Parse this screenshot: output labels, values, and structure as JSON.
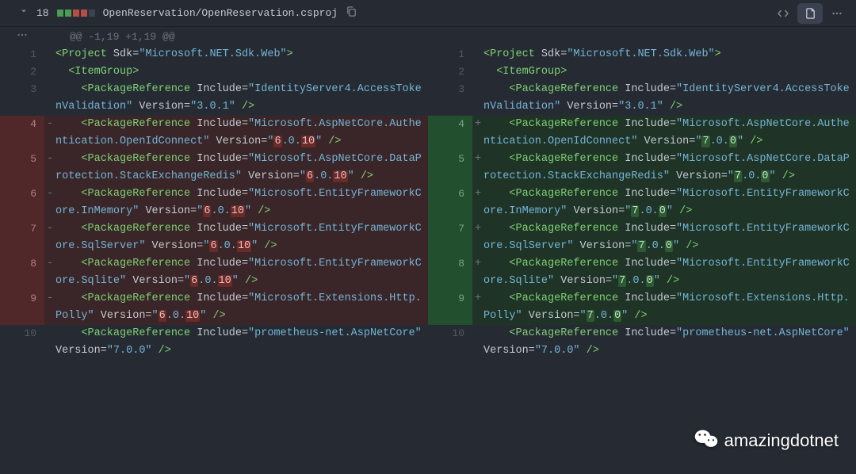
{
  "header": {
    "changed_lines": "18",
    "path": "OpenReservation/OpenReservation.csproj"
  },
  "hunk": "@@ -1,19 +1,19 @@",
  "watermark": "amazingdotnet",
  "lines": {
    "left": [
      {
        "num": "1",
        "type": "ctx",
        "indent": 0,
        "segs": [
          {
            "t": "tag",
            "v": "<Project "
          },
          {
            "t": "attr",
            "v": "Sdk="
          },
          {
            "t": "str",
            "v": "\"Microsoft.NET.Sdk.Web\""
          },
          {
            "t": "tag",
            "v": ">"
          }
        ]
      },
      {
        "num": "2",
        "type": "ctx",
        "indent": 2,
        "segs": [
          {
            "t": "tag",
            "v": "<ItemGroup>"
          }
        ]
      },
      {
        "num": "3",
        "type": "ctx",
        "indent": 4,
        "segs": [
          {
            "t": "tag",
            "v": "<PackageReference "
          },
          {
            "t": "attr",
            "v": "Include="
          },
          {
            "t": "str",
            "v": "\"IdentityServer4.AccessTokenValidation\""
          },
          {
            "t": "punc",
            "v": " "
          },
          {
            "t": "attr",
            "v": "Version="
          },
          {
            "t": "str",
            "v": "\"3.0.1\""
          },
          {
            "t": "tag",
            "v": " />"
          }
        ]
      },
      {
        "num": "4",
        "type": "del",
        "indent": 4,
        "segs": [
          {
            "t": "tag",
            "v": "<PackageReference "
          },
          {
            "t": "attr",
            "v": "Include="
          },
          {
            "t": "str",
            "v": "\"Microsoft.AspNetCore.Authentication.OpenIdConnect\""
          },
          {
            "t": "punc",
            "v": " "
          },
          {
            "t": "attr",
            "v": "Version="
          },
          {
            "t": "str",
            "v": "\""
          },
          {
            "t": "hl",
            "v": "6"
          },
          {
            "t": "str",
            "v": ".0."
          },
          {
            "t": "hl",
            "v": "10"
          },
          {
            "t": "str",
            "v": "\""
          },
          {
            "t": "tag",
            "v": " />"
          }
        ]
      },
      {
        "num": "5",
        "type": "del",
        "indent": 4,
        "segs": [
          {
            "t": "tag",
            "v": "<PackageReference "
          },
          {
            "t": "attr",
            "v": "Include="
          },
          {
            "t": "str",
            "v": "\"Microsoft.AspNetCore.DataProtection.StackExchangeRedis\""
          },
          {
            "t": "punc",
            "v": " "
          },
          {
            "t": "attr",
            "v": "Version="
          },
          {
            "t": "str",
            "v": "\""
          },
          {
            "t": "hl",
            "v": "6"
          },
          {
            "t": "str",
            "v": ".0."
          },
          {
            "t": "hl",
            "v": "10"
          },
          {
            "t": "str",
            "v": "\""
          },
          {
            "t": "tag",
            "v": " />"
          }
        ]
      },
      {
        "num": "6",
        "type": "del",
        "indent": 4,
        "segs": [
          {
            "t": "tag",
            "v": "<PackageReference "
          },
          {
            "t": "attr",
            "v": "Include="
          },
          {
            "t": "str",
            "v": "\"Microsoft.EntityFrameworkCore.InMemory\""
          },
          {
            "t": "punc",
            "v": " "
          },
          {
            "t": "attr",
            "v": "Version="
          },
          {
            "t": "str",
            "v": "\""
          },
          {
            "t": "hl",
            "v": "6"
          },
          {
            "t": "str",
            "v": ".0."
          },
          {
            "t": "hl",
            "v": "10"
          },
          {
            "t": "str",
            "v": "\""
          },
          {
            "t": "tag",
            "v": " />"
          }
        ]
      },
      {
        "num": "7",
        "type": "del",
        "indent": 4,
        "segs": [
          {
            "t": "tag",
            "v": "<PackageReference "
          },
          {
            "t": "attr",
            "v": "Include="
          },
          {
            "t": "str",
            "v": "\"Microsoft.EntityFrameworkCore.SqlServer\""
          },
          {
            "t": "punc",
            "v": " "
          },
          {
            "t": "attr",
            "v": "Version="
          },
          {
            "t": "str",
            "v": "\""
          },
          {
            "t": "hl",
            "v": "6"
          },
          {
            "t": "str",
            "v": ".0."
          },
          {
            "t": "hl",
            "v": "10"
          },
          {
            "t": "str",
            "v": "\""
          },
          {
            "t": "tag",
            "v": " />"
          }
        ]
      },
      {
        "num": "8",
        "type": "del",
        "indent": 4,
        "segs": [
          {
            "t": "tag",
            "v": "<PackageReference "
          },
          {
            "t": "attr",
            "v": "Include="
          },
          {
            "t": "str",
            "v": "\"Microsoft.EntityFrameworkCore.Sqlite\""
          },
          {
            "t": "punc",
            "v": " "
          },
          {
            "t": "attr",
            "v": "Version="
          },
          {
            "t": "str",
            "v": "\""
          },
          {
            "t": "hl",
            "v": "6"
          },
          {
            "t": "str",
            "v": ".0."
          },
          {
            "t": "hl",
            "v": "10"
          },
          {
            "t": "str",
            "v": "\""
          },
          {
            "t": "tag",
            "v": " />"
          }
        ]
      },
      {
        "num": "9",
        "type": "del",
        "indent": 4,
        "segs": [
          {
            "t": "tag",
            "v": "<PackageReference "
          },
          {
            "t": "attr",
            "v": "Include="
          },
          {
            "t": "str",
            "v": "\"Microsoft.Extensions.Http.Polly\""
          },
          {
            "t": "punc",
            "v": " "
          },
          {
            "t": "attr",
            "v": "Version="
          },
          {
            "t": "str",
            "v": "\""
          },
          {
            "t": "hl",
            "v": "6"
          },
          {
            "t": "str",
            "v": ".0."
          },
          {
            "t": "hl",
            "v": "10"
          },
          {
            "t": "str",
            "v": "\""
          },
          {
            "t": "tag",
            "v": " />"
          }
        ]
      },
      {
        "num": "10",
        "type": "ctx",
        "indent": 4,
        "segs": [
          {
            "t": "tag",
            "v": "<PackageReference "
          },
          {
            "t": "attr",
            "v": "Include="
          },
          {
            "t": "str",
            "v": "\"prometheus-net.AspNetCore\""
          },
          {
            "t": "punc",
            "v": " "
          },
          {
            "t": "attr",
            "v": "Version="
          },
          {
            "t": "str",
            "v": "\"7.0.0\""
          },
          {
            "t": "tag",
            "v": " />"
          }
        ]
      }
    ],
    "right": [
      {
        "num": "1",
        "type": "ctx",
        "indent": 0,
        "segs": [
          {
            "t": "tag",
            "v": "<Project "
          },
          {
            "t": "attr",
            "v": "Sdk="
          },
          {
            "t": "str",
            "v": "\"Microsoft.NET.Sdk.Web\""
          },
          {
            "t": "tag",
            "v": ">"
          }
        ]
      },
      {
        "num": "2",
        "type": "ctx",
        "indent": 2,
        "segs": [
          {
            "t": "tag",
            "v": "<ItemGroup>"
          }
        ]
      },
      {
        "num": "3",
        "type": "ctx",
        "indent": 4,
        "segs": [
          {
            "t": "tag",
            "v": "<PackageReference "
          },
          {
            "t": "attr",
            "v": "Include="
          },
          {
            "t": "str",
            "v": "\"IdentityServer4.AccessTokenValidation\""
          },
          {
            "t": "punc",
            "v": " "
          },
          {
            "t": "attr",
            "v": "Version="
          },
          {
            "t": "str",
            "v": "\"3.0.1\""
          },
          {
            "t": "tag",
            "v": " />"
          }
        ]
      },
      {
        "num": "4",
        "type": "add",
        "indent": 4,
        "segs": [
          {
            "t": "tag",
            "v": "<PackageReference "
          },
          {
            "t": "attr",
            "v": "Include="
          },
          {
            "t": "str",
            "v": "\"Microsoft.AspNetCore.Authentication.OpenIdConnect\""
          },
          {
            "t": "punc",
            "v": " "
          },
          {
            "t": "attr",
            "v": "Version="
          },
          {
            "t": "str",
            "v": "\""
          },
          {
            "t": "hl",
            "v": "7"
          },
          {
            "t": "str",
            "v": ".0."
          },
          {
            "t": "hl",
            "v": "0"
          },
          {
            "t": "str",
            "v": "\""
          },
          {
            "t": "tag",
            "v": " />"
          }
        ]
      },
      {
        "num": "5",
        "type": "add",
        "indent": 4,
        "segs": [
          {
            "t": "tag",
            "v": "<PackageReference "
          },
          {
            "t": "attr",
            "v": "Include="
          },
          {
            "t": "str",
            "v": "\"Microsoft.AspNetCore.DataProtection.StackExchangeRedis\""
          },
          {
            "t": "punc",
            "v": " "
          },
          {
            "t": "attr",
            "v": "Version="
          },
          {
            "t": "str",
            "v": "\""
          },
          {
            "t": "hl",
            "v": "7"
          },
          {
            "t": "str",
            "v": ".0."
          },
          {
            "t": "hl",
            "v": "0"
          },
          {
            "t": "str",
            "v": "\""
          },
          {
            "t": "tag",
            "v": " />"
          }
        ]
      },
      {
        "num": "6",
        "type": "add",
        "indent": 4,
        "segs": [
          {
            "t": "tag",
            "v": "<PackageReference "
          },
          {
            "t": "attr",
            "v": "Include="
          },
          {
            "t": "str",
            "v": "\"Microsoft.EntityFrameworkCore.InMemory\""
          },
          {
            "t": "punc",
            "v": " "
          },
          {
            "t": "attr",
            "v": "Version="
          },
          {
            "t": "str",
            "v": "\""
          },
          {
            "t": "hl",
            "v": "7"
          },
          {
            "t": "str",
            "v": ".0."
          },
          {
            "t": "hl",
            "v": "0"
          },
          {
            "t": "str",
            "v": "\""
          },
          {
            "t": "tag",
            "v": " />"
          }
        ]
      },
      {
        "num": "7",
        "type": "add",
        "indent": 4,
        "segs": [
          {
            "t": "tag",
            "v": "<PackageReference "
          },
          {
            "t": "attr",
            "v": "Include="
          },
          {
            "t": "str",
            "v": "\"Microsoft.EntityFrameworkCore.SqlServer\""
          },
          {
            "t": "punc",
            "v": " "
          },
          {
            "t": "attr",
            "v": "Version="
          },
          {
            "t": "str",
            "v": "\""
          },
          {
            "t": "hl",
            "v": "7"
          },
          {
            "t": "str",
            "v": ".0."
          },
          {
            "t": "hl",
            "v": "0"
          },
          {
            "t": "str",
            "v": "\""
          },
          {
            "t": "tag",
            "v": " />"
          }
        ]
      },
      {
        "num": "8",
        "type": "add",
        "indent": 4,
        "segs": [
          {
            "t": "tag",
            "v": "<PackageReference "
          },
          {
            "t": "attr",
            "v": "Include="
          },
          {
            "t": "str",
            "v": "\"Microsoft.EntityFrameworkCore.Sqlite\""
          },
          {
            "t": "punc",
            "v": " "
          },
          {
            "t": "attr",
            "v": "Version="
          },
          {
            "t": "str",
            "v": "\""
          },
          {
            "t": "hl",
            "v": "7"
          },
          {
            "t": "str",
            "v": ".0."
          },
          {
            "t": "hl",
            "v": "0"
          },
          {
            "t": "str",
            "v": "\""
          },
          {
            "t": "tag",
            "v": " />"
          }
        ]
      },
      {
        "num": "9",
        "type": "add",
        "indent": 4,
        "segs": [
          {
            "t": "tag",
            "v": "<PackageReference "
          },
          {
            "t": "attr",
            "v": "Include="
          },
          {
            "t": "str",
            "v": "\"Microsoft.Extensions.Http.Polly\""
          },
          {
            "t": "punc",
            "v": " "
          },
          {
            "t": "attr",
            "v": "Version="
          },
          {
            "t": "str",
            "v": "\""
          },
          {
            "t": "hl",
            "v": "7"
          },
          {
            "t": "str",
            "v": ".0."
          },
          {
            "t": "hl",
            "v": "0"
          },
          {
            "t": "str",
            "v": "\""
          },
          {
            "t": "tag",
            "v": " />"
          }
        ]
      },
      {
        "num": "10",
        "type": "ctx",
        "indent": 4,
        "segs": [
          {
            "t": "tag",
            "v": "<PackageReference "
          },
          {
            "t": "attr",
            "v": "Include="
          },
          {
            "t": "str",
            "v": "\"prometheus-net.AspNetCore\""
          },
          {
            "t": "punc",
            "v": " "
          },
          {
            "t": "attr",
            "v": "Version="
          },
          {
            "t": "str",
            "v": "\"7.0.0\""
          },
          {
            "t": "tag",
            "v": " />"
          }
        ]
      }
    ]
  }
}
